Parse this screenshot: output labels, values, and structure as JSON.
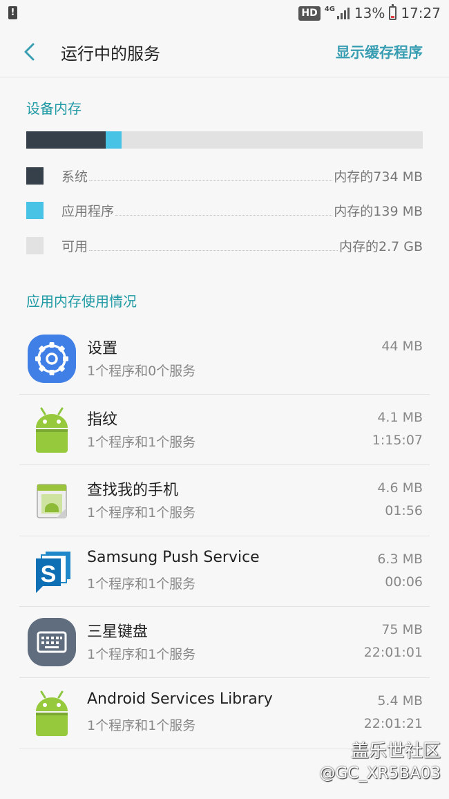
{
  "status_bar": {
    "hd": "HD",
    "network": "4G",
    "battery": "13%",
    "time": "17:27"
  },
  "header": {
    "title": "运行中的服务",
    "action": "显示缓存程序"
  },
  "device_memory": {
    "title": "设备内存",
    "bar": {
      "system_fraction": 0.2,
      "app_fraction": 0.04
    },
    "legend": [
      {
        "label": "系统",
        "value": "内存的734 MB",
        "color": "#36404a"
      },
      {
        "label": "应用程序",
        "value": "内存的139 MB",
        "color": "#48c3e6"
      },
      {
        "label": "可用",
        "value": "内存的2.7 GB",
        "color": "#e2e2e2"
      }
    ]
  },
  "app_usage": {
    "title": "应用内存使用情况",
    "apps": [
      {
        "name": "设置",
        "sub": "1个程序和0个服务",
        "size": "44 MB",
        "time": "",
        "icon": "settings-gear-icon"
      },
      {
        "name": "指纹",
        "sub": "1个程序和1个服务",
        "size": "4.1 MB",
        "time": "1:15:07",
        "icon": "android-robot-icon"
      },
      {
        "name": "查找我的手机",
        "sub": "1个程序和1个服务",
        "size": "4.6 MB",
        "time": "01:56",
        "icon": "android-package-icon"
      },
      {
        "name": "Samsung Push Service",
        "sub": "1个程序和1个服务",
        "size": "6.3 MB",
        "time": "00:06",
        "icon": "samsung-push-icon"
      },
      {
        "name": "三星键盘",
        "sub": "1个程序和1个服务",
        "size": "75 MB",
        "time": "22:01:01",
        "icon": "keyboard-icon"
      },
      {
        "name": "Android Services Library",
        "sub": "1个程序和1个服务",
        "size": "5.4 MB",
        "time": "22:01:21",
        "icon": "android-robot-icon"
      }
    ]
  },
  "watermark": {
    "brand": "盖乐世社区",
    "user": "@GC_XR5BA03"
  }
}
